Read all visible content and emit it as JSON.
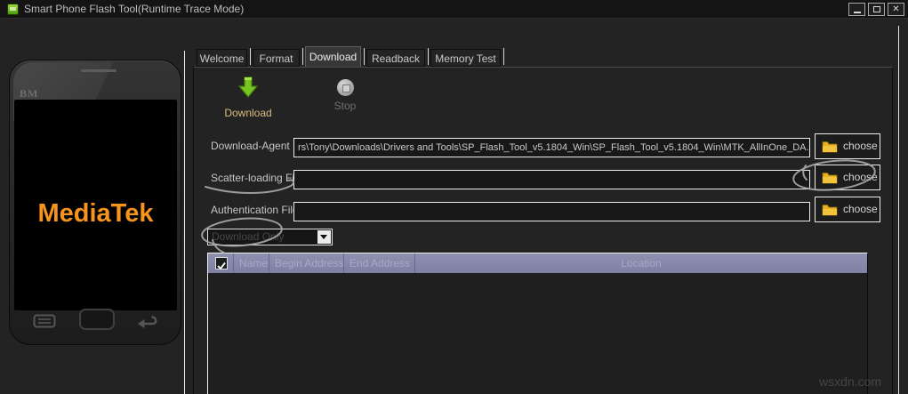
{
  "window": {
    "title": "Smart Phone Flash Tool(Runtime Trace Mode)",
    "close_glyph": "✕"
  },
  "phone": {
    "corner_brand": "BM",
    "brand": "MediaTek"
  },
  "tabs": [
    {
      "label": "Welcome",
      "active": false
    },
    {
      "label": "Format",
      "active": false
    },
    {
      "label": "Download",
      "active": true
    },
    {
      "label": "Readback",
      "active": false
    },
    {
      "label": "Memory Test",
      "active": false
    }
  ],
  "toolbar": {
    "download_label": "Download",
    "stop_label": "Stop"
  },
  "form": {
    "download_agent": {
      "label": "Download-Agent",
      "value": "rs\\Tony\\Downloads\\Drivers and Tools\\SP_Flash_Tool_v5.1804_Win\\SP_Flash_Tool_v5.1804_Win\\MTK_AllInOne_DA.bin",
      "button": "choose"
    },
    "scatter_file": {
      "label": "Scatter-loading File",
      "value": "",
      "button": "choose"
    },
    "auth_file": {
      "label": "Authentication File",
      "value": "",
      "button": "choose"
    },
    "mode_select": {
      "value": "Download Only"
    }
  },
  "table": {
    "header_checkbox_checked": true,
    "headers": [
      "Name",
      "Begin Address",
      "End Address",
      "Location"
    ],
    "rows": []
  },
  "watermark": "wsxdn.com",
  "colors": {
    "accent_green": "#76c41d",
    "folder_yellow": "#e9b11f",
    "header_purple": "#8587aa",
    "mediatek_orange": "#f7941d",
    "download_label_gold": "#d9bd7e",
    "annotation_gray": "#ababab"
  }
}
